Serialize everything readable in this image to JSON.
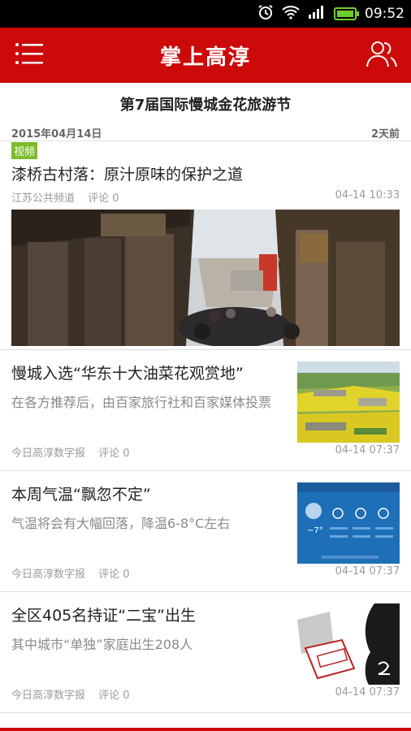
{
  "status": {
    "time": "09:52",
    "battery_level": 1.0,
    "icons": [
      "alarm-icon",
      "wifi-icon",
      "signal-icon",
      "battery-icon"
    ]
  },
  "header": {
    "title": "掌上高淳",
    "menu_icon": "menu-icon",
    "user_icon": "users-icon",
    "color": "#cc0a0a"
  },
  "section": {
    "title": "第7届国际慢城金花旅游节",
    "date": "2015年04月14日",
    "relative": "2天前"
  },
  "featured": {
    "badge": "视频",
    "headline": "漆桥古村落：原汁原味的保护之道",
    "source": "江苏公共频道",
    "comments": "评论 0",
    "time": "04-14 10:33"
  },
  "items": [
    {
      "headline": "慢城入选“华东十大油菜花观赏地”",
      "desc": "在各方推荐后，由百家旅行社和百家媒体投票",
      "source": "今日高淳数字报",
      "comments": "评论 0",
      "time": "04-14 07:37"
    },
    {
      "headline": "本周气温“飘忽不定”",
      "desc": "气温将会有大幅回落，降温6-8°C左右",
      "source": "今日高淳数字报",
      "comments": "评论 0",
      "time": "04-14 07:37"
    },
    {
      "headline": "全区405名持证“二宝”出生",
      "desc": "其中城市“单独”家庭出生208人",
      "source": "今日高淳数字报",
      "comments": "评论 0",
      "time": "04-14 07:37"
    }
  ]
}
